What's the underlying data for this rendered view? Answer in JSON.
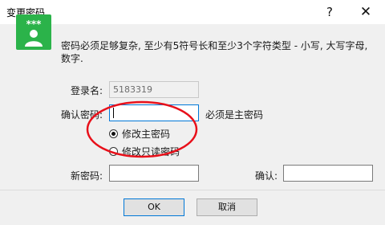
{
  "window": {
    "title": "变更密码",
    "help_symbol": "?",
    "close_symbol": "✕"
  },
  "icon": {
    "name": "user-key-icon",
    "glyph": "***",
    "color": "#2bb34a"
  },
  "description": "密码必须足够复杂, 至少有5符号长和至少3个字符类型 - 小写, 大写字母, 数字.",
  "form": {
    "login_label": "登录名:",
    "login_value": "5183319",
    "confirm_label": "确认密码:",
    "confirm_value": "",
    "confirm_hint": "必须是主密码",
    "radio_options": [
      {
        "label": "修改主密码",
        "checked": true
      },
      {
        "label": "修改只读密码",
        "checked": false
      }
    ],
    "new_password_label": "新密码:",
    "new_password_value": "",
    "confirm_new_label": "确认:",
    "confirm_new_value": ""
  },
  "buttons": {
    "ok": "OK",
    "cancel": "取消"
  },
  "colors": {
    "annotation": "#e8101a",
    "focus_border": "#0078d7",
    "panel_bg": "#f0f0f0"
  }
}
